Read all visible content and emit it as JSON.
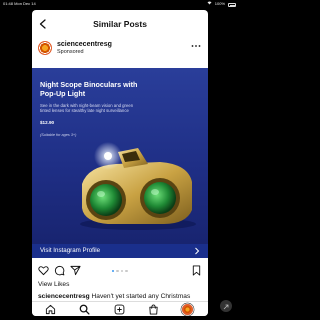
{
  "status_bar": {
    "time": "01:48",
    "date": "Mon Dec 14",
    "battery": "100%"
  },
  "header": {
    "title": "Similar Posts"
  },
  "post": {
    "username": "sciencecentresg",
    "sponsored_label": "Sponsored",
    "ad": {
      "title": "Night Scope Binoculars with Pop-Up Light",
      "description": "See in the dark with night-beam vision and green tinted lenses for stealthy late night surveillance",
      "price": "$12.90",
      "ages": "(Suitable for ages 3+)"
    },
    "cta_label": "Visit Instagram Profile",
    "carousel": {
      "count": 4,
      "active_index": 0
    },
    "view_likes_label": "View Likes",
    "caption_username": "sciencecentresg",
    "caption_text": "Haven't yet started any Christmas"
  },
  "colors": {
    "ad_background": "#24378f",
    "cta_background": "#1a2f8c",
    "carousel_active": "#3897f0"
  },
  "icons": [
    "back-arrow",
    "more-dots",
    "heart",
    "comment",
    "share",
    "bookmark",
    "home",
    "search",
    "new-post",
    "shop",
    "profile"
  ]
}
